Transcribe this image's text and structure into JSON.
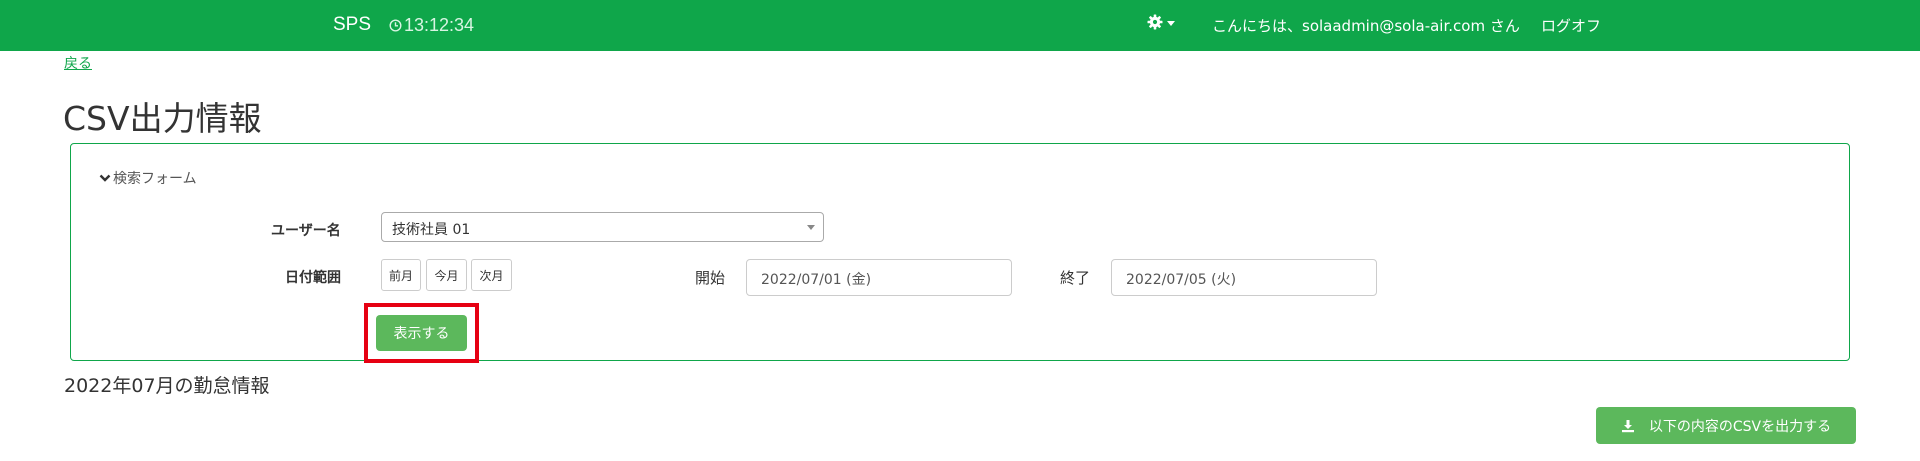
{
  "navbar": {
    "brand": "SPS",
    "clock": "13:12:34",
    "clock_icon": "clock-icon",
    "settings_icon": "gear-icon",
    "greeting": "こんにちは、solaadmin@sola-air.com さん",
    "logout": "ログオフ",
    "color": "#0fa64a"
  },
  "back_link": "戻る",
  "page_title": "CSV出力情報",
  "search_form": {
    "toggle_label": "検索フォーム",
    "toggle_icon": "chevron-down-icon",
    "user_label": "ユーザー名",
    "user_value": "技術社員 01",
    "date_range_label": "日付範囲",
    "buttons": [
      "前月",
      "今月",
      "次月"
    ],
    "start_label": "開始",
    "start_value": "2022/07/01 (金)",
    "end_label": "終了",
    "end_value": "2022/07/05 (火)",
    "submit": "表示する"
  },
  "section_title": "2022年07月の勤怠情報",
  "csv_button": {
    "label": "以下の内容のCSVを出力する",
    "icon": "download-icon"
  },
  "colors": {
    "primary": "#0fa64a",
    "button_green": "#5cb85c",
    "highlight": "#e60012"
  }
}
